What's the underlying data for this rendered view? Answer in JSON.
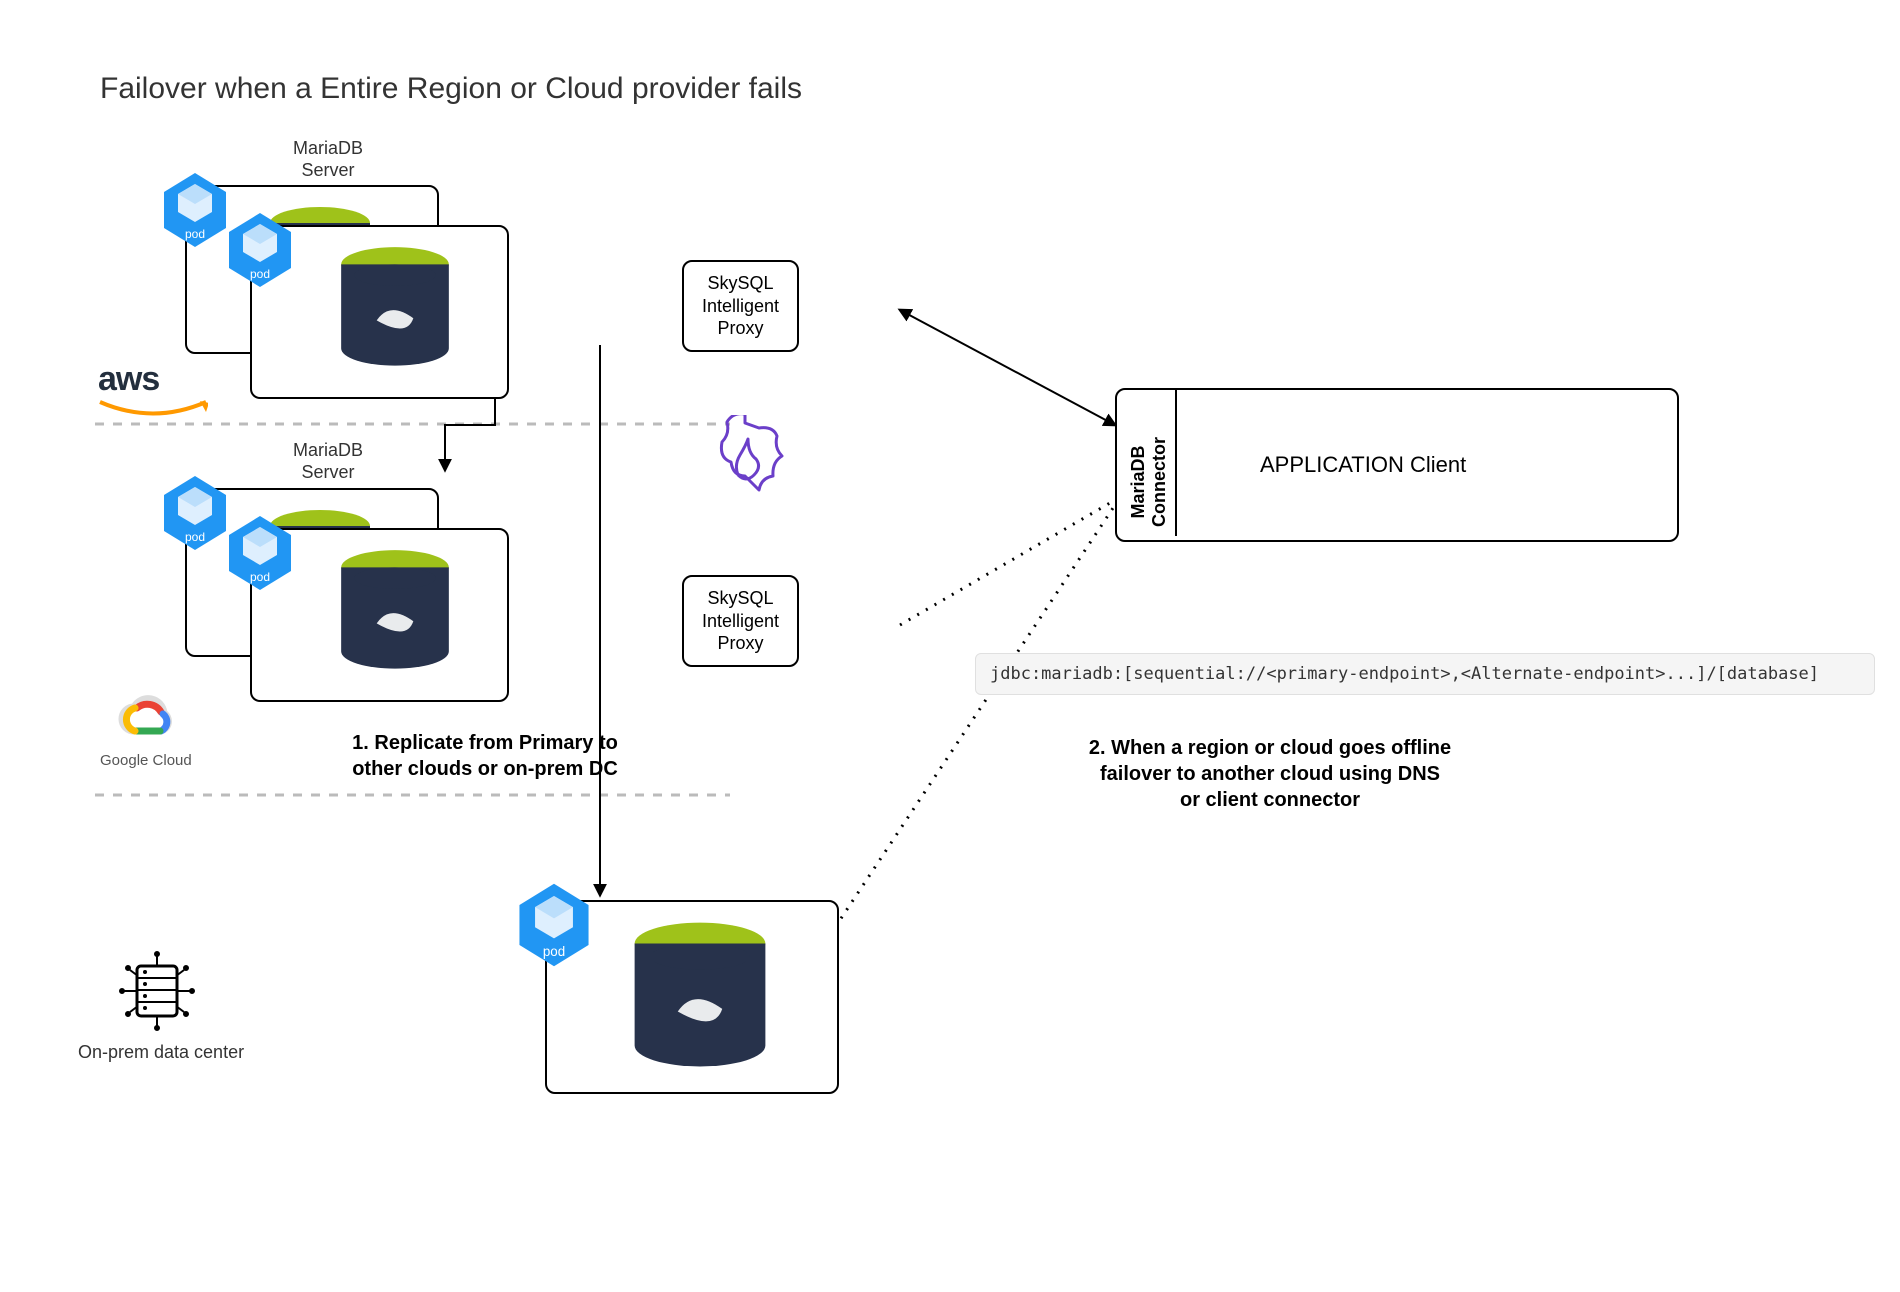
{
  "title": "Failover when a Entire Region or Cloud provider fails",
  "mariadb_server_label": "MariaDB\nServer",
  "pod_label": "pod",
  "aws_label": "aws",
  "gcloud_label": "Google Cloud",
  "onprem_label": "On-prem data center",
  "proxy_label": "SkySQL\nIntelligent\nProxy",
  "connector_label": "MariaDB\nConnector",
  "app_label": "APPLICATION Client",
  "jdbc_line": "jdbc:mariadb:[sequential://<primary-endpoint>,<Alternate-endpoint>...]/[database]",
  "caption1": "1. Replicate from Primary to\nother clouds or on-prem DC",
  "caption2": "2. When a region or cloud goes offline\nfailover to another cloud using DNS\nor client connector"
}
